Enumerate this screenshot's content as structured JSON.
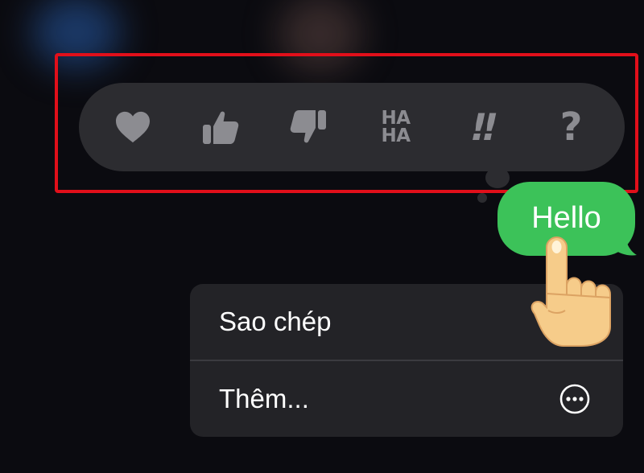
{
  "tapback_reactions": [
    {
      "name": "heart-icon"
    },
    {
      "name": "thumbs-up-icon"
    },
    {
      "name": "thumbs-down-icon"
    },
    {
      "name": "haha-icon",
      "label_line1": "HA",
      "label_line2": "HA"
    },
    {
      "name": "exclamation-icon",
      "label": "!!"
    },
    {
      "name": "question-icon",
      "label": "?"
    }
  ],
  "message": {
    "text": "Hello",
    "bubble_color": "#3cc259"
  },
  "context_menu": {
    "copy_label": "Sao chép",
    "more_label": "Thêm...",
    "more_icon": "ellipsis-circle-icon"
  },
  "colors": {
    "highlight": "#e10f1a",
    "tapback_bar": "#2c2c30",
    "tapback_icon": "#8c8c91",
    "menu_bg": "#232327"
  }
}
